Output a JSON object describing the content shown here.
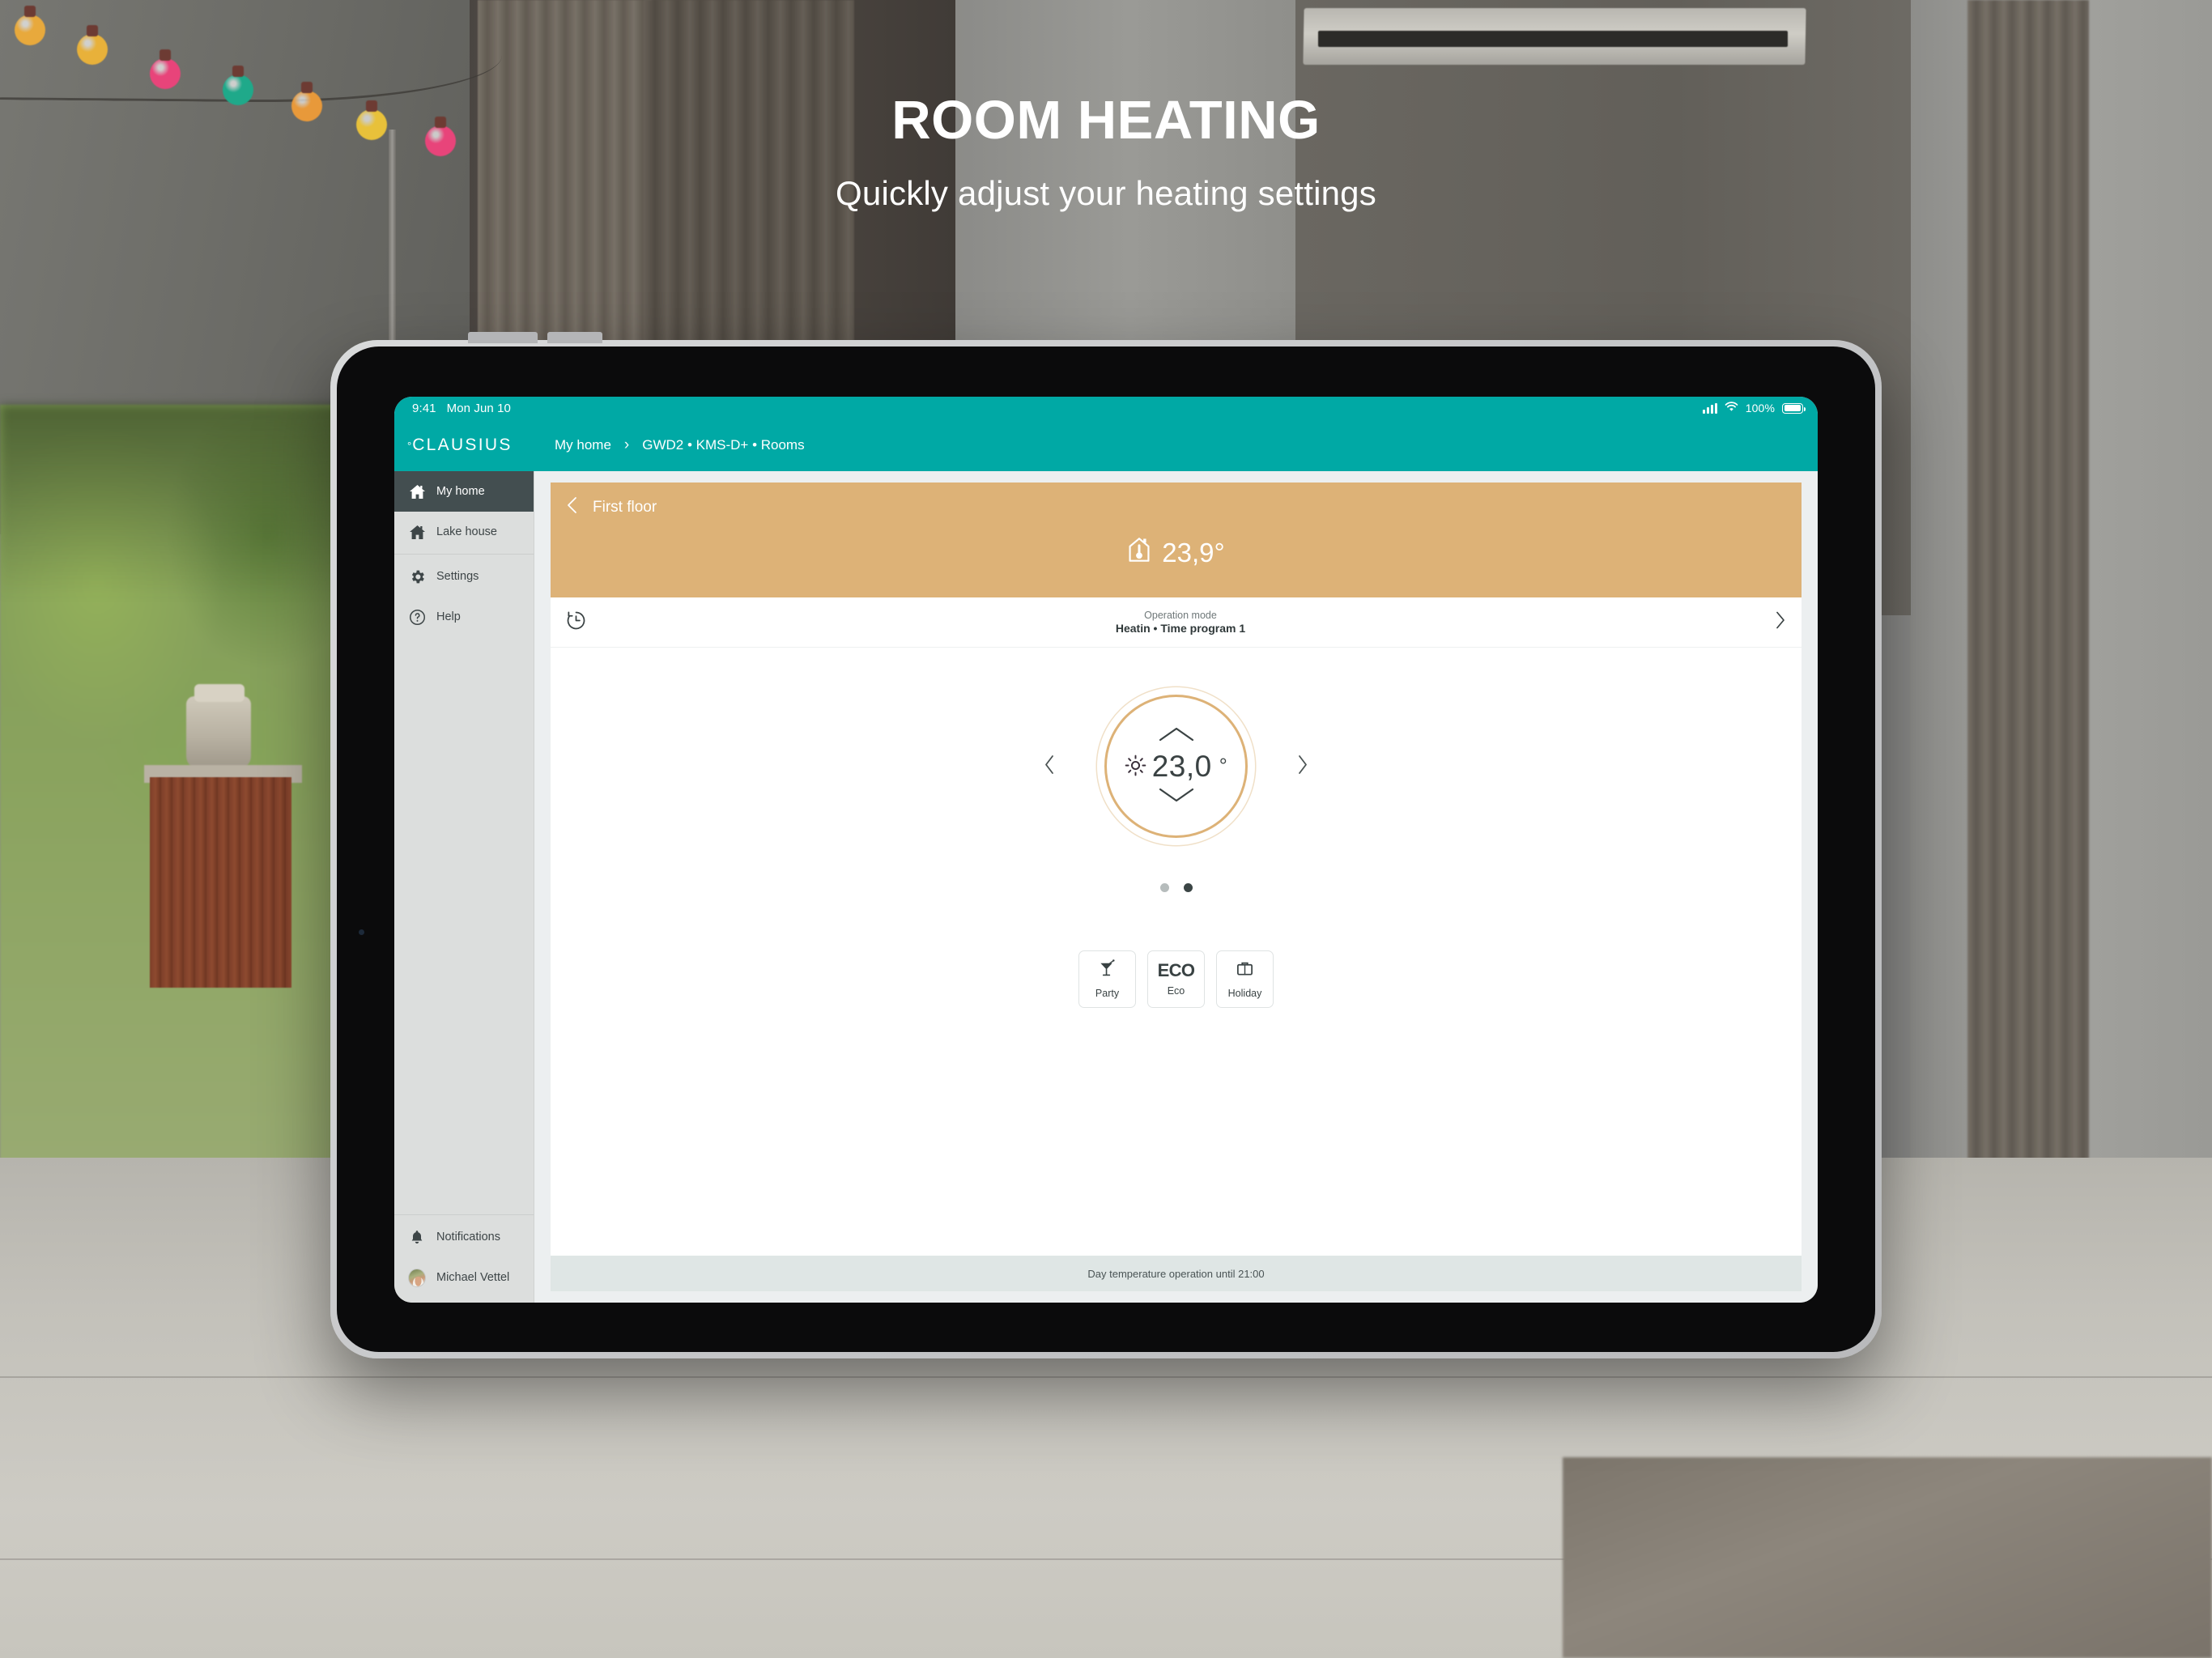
{
  "hero": {
    "title": "ROOM HEATING",
    "subtitle": "Quickly adjust your heating settings"
  },
  "colors": {
    "brand_teal": "#00A9A5",
    "accent_tan": "#ddb277",
    "sidebar_bg": "#dcdedd",
    "sidebar_active": "#434e50",
    "footer_bg": "#dfe6e5",
    "text_dark": "#3a4243"
  },
  "statusbar": {
    "time": "9:41",
    "date": "Mon Jun 10",
    "battery_percent": "100%",
    "signal_icon": "cellular-signal-icon",
    "wifi_icon": "wifi-icon",
    "battery_icon": "battery-icon"
  },
  "topbar": {
    "logo_degree": "°",
    "logo_text": "CLAUSIUS",
    "breadcrumb": {
      "home": "My home",
      "separator": "›",
      "path": "GWD2 • KMS-D+ • Rooms"
    }
  },
  "sidebar": {
    "items": [
      {
        "label": "My home",
        "icon": "home-icon",
        "active": true
      },
      {
        "label": "Lake house",
        "icon": "home-icon",
        "active": false
      },
      {
        "label": "Settings",
        "icon": "gear-icon",
        "active": false
      },
      {
        "label": "Help",
        "icon": "help-icon",
        "active": false
      }
    ],
    "bottom": [
      {
        "label": "Notifications",
        "icon": "bell-icon"
      },
      {
        "label": "Michael Vettel",
        "icon": "avatar"
      }
    ]
  },
  "room": {
    "back_icon": "chevron-left-icon",
    "name": "First floor",
    "temperature_icon": "house-thermometer-icon",
    "current_temperature": "23,9°"
  },
  "operation_mode": {
    "icon": "clock-history-icon",
    "label": "Operation mode",
    "value": "Heatin • Time program 1",
    "chevron_icon": "chevron-right-icon"
  },
  "dial": {
    "prev_icon": "chevron-left-icon",
    "next_icon": "chevron-right-icon",
    "up_icon": "chevron-up-icon",
    "down_icon": "chevron-down-icon",
    "mode_icon": "sun-icon",
    "setpoint": "23,0",
    "degree": "°"
  },
  "pagination": {
    "total": 2,
    "active_index": 1
  },
  "quick_modes": [
    {
      "label": "Party",
      "icon": "cocktail-glass-icon",
      "text": ""
    },
    {
      "label": "Eco",
      "icon": "eco-text-icon",
      "text": "ECO"
    },
    {
      "label": "Holiday",
      "icon": "suitcase-icon",
      "text": ""
    }
  ],
  "footer": {
    "status": "Day temperature operation until 21:00"
  },
  "string_lights": {
    "bulbs": [
      "#e8a93c",
      "#e8b13a",
      "#e8447a",
      "#1fa98a",
      "#e8993a",
      "#e8c13a",
      "#e8447a"
    ]
  }
}
